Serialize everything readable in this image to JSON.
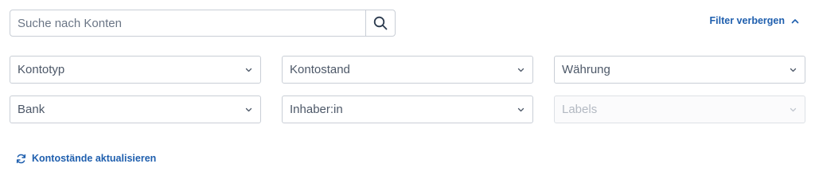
{
  "search": {
    "placeholder": "Suche nach Konten",
    "value": "",
    "icon": "search-icon"
  },
  "filter_toggle": {
    "label": "Filter verbergen",
    "icon": "chevron-up-icon"
  },
  "filters": {
    "account_type": {
      "label": "Kontotyp",
      "disabled": false
    },
    "balance": {
      "label": "Kontostand",
      "disabled": false
    },
    "currency": {
      "label": "Währung",
      "disabled": false
    },
    "bank": {
      "label": "Bank",
      "disabled": false
    },
    "owner": {
      "label": "Inhaber:in",
      "disabled": false
    },
    "labels": {
      "label": "Labels",
      "disabled": true
    }
  },
  "refresh": {
    "label": "Kontostände aktualisieren",
    "icon": "refresh-icon"
  },
  "colors": {
    "accent": "#1f5fae",
    "border": "#c9ced6",
    "text": "#4d5868",
    "disabled_text": "#b3b9c2"
  }
}
